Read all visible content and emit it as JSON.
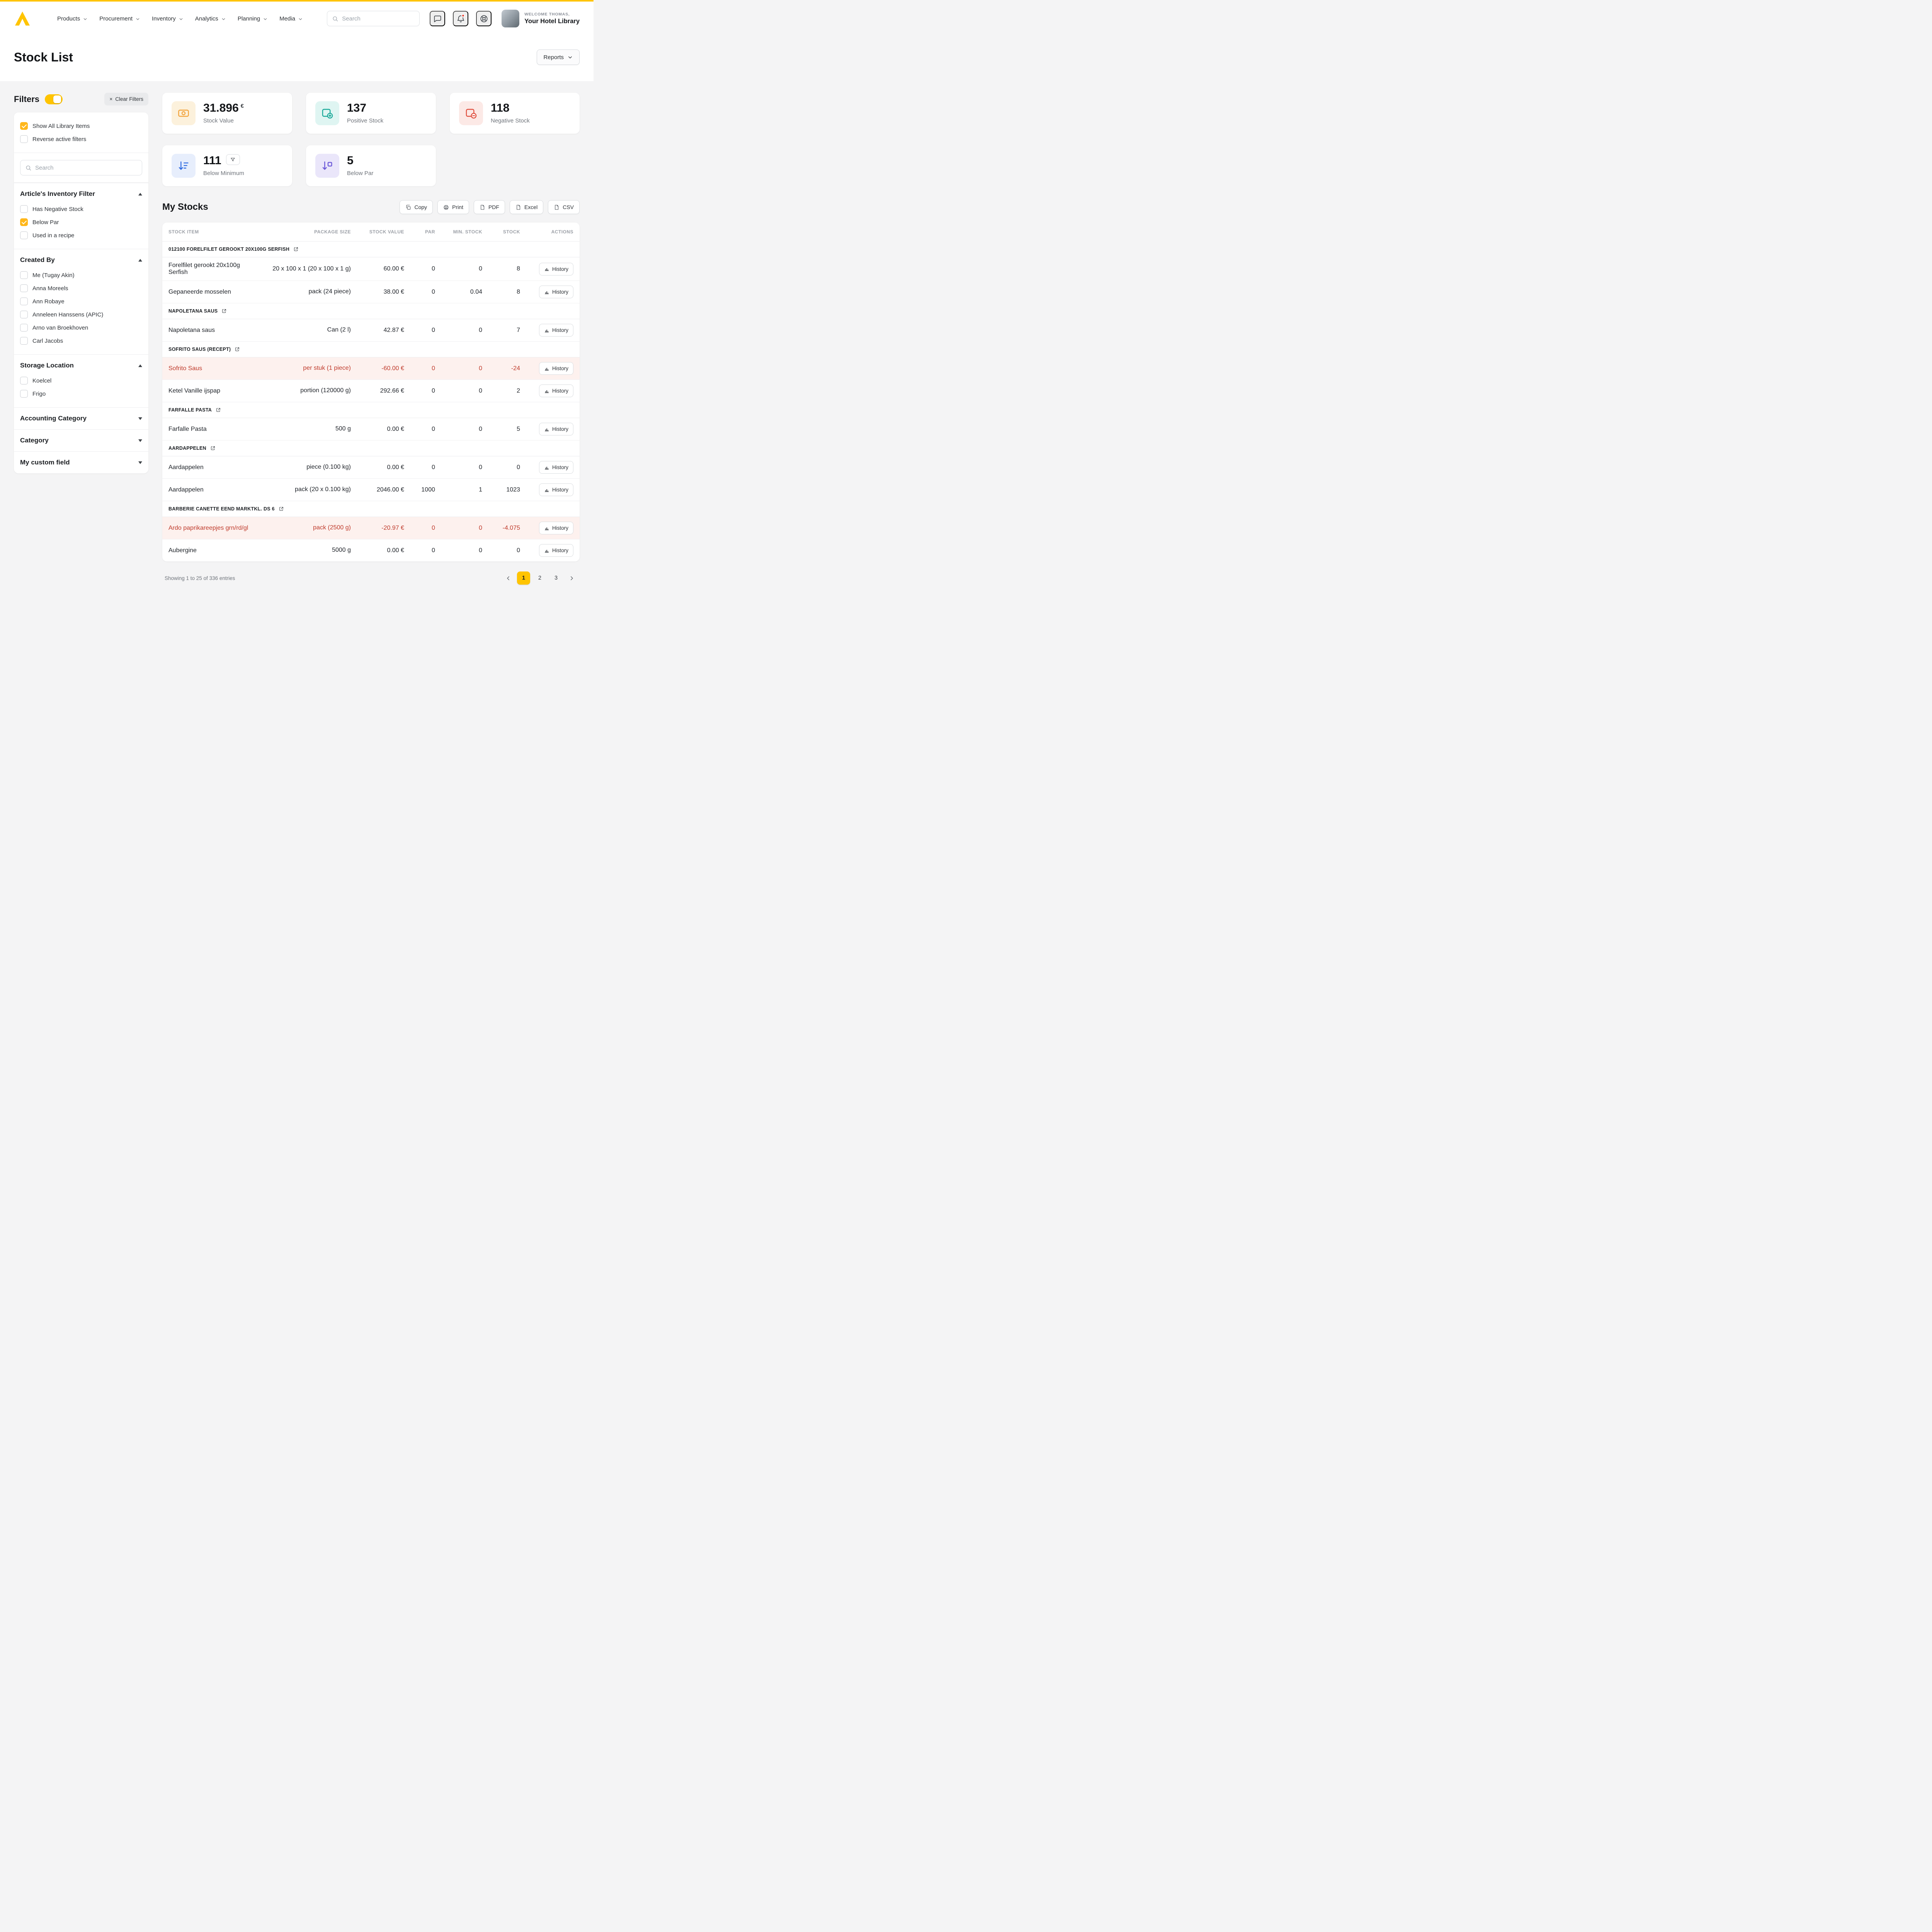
{
  "accent": "#ffc400",
  "header": {
    "nav": [
      {
        "label": "Products"
      },
      {
        "label": "Procurement"
      },
      {
        "label": "Inventory"
      },
      {
        "label": "Analytics"
      },
      {
        "label": "Planning"
      },
      {
        "label": "Media"
      }
    ],
    "search": {
      "placeholder": "Search",
      "icon": "search-icon"
    },
    "action_icons": [
      {
        "name": "chat-icon",
        "badge": false
      },
      {
        "name": "bell-icon",
        "badge": true
      },
      {
        "name": "help-icon",
        "badge": false
      }
    ],
    "user": {
      "welcome": "WELCOME THOMAS,",
      "account": "Your Hotel Library"
    }
  },
  "page": {
    "title": "Stock List",
    "reports_button": "Reports"
  },
  "filters": {
    "title": "Filters",
    "toggle_on": true,
    "clear_icon": "×",
    "clear_button": "Clear Filters",
    "search_placeholder": "Search",
    "top_options": [
      {
        "label": "Show All Library Items",
        "checked": true
      },
      {
        "label": "Reverse active filters",
        "checked": false
      }
    ],
    "sections": [
      {
        "title": "Article's Inventory Filter",
        "expanded": true,
        "options": [
          {
            "label": "Has Negative Stock",
            "checked": false
          },
          {
            "label": "Below Par",
            "checked": true
          },
          {
            "label": "Used in a recipe",
            "checked": false
          }
        ]
      },
      {
        "title": "Created By",
        "expanded": true,
        "options": [
          {
            "label": "Me (Tugay Akin)",
            "checked": false
          },
          {
            "label": "Anna Moreels",
            "checked": false
          },
          {
            "label": "Ann Robaye",
            "checked": false
          },
          {
            "label": "Anneleen Hanssens (APIC)",
            "checked": false
          },
          {
            "label": "Arno van Broekhoven",
            "checked": false
          },
          {
            "label": "Carl Jacobs",
            "checked": false
          }
        ]
      },
      {
        "title": "Storage Location",
        "expanded": true,
        "options": [
          {
            "label": "Koelcel",
            "checked": false
          },
          {
            "label": "Frigo",
            "checked": false
          }
        ]
      },
      {
        "title": "Accounting Category",
        "expanded": false,
        "options": []
      },
      {
        "title": "Category",
        "expanded": false,
        "options": []
      },
      {
        "title": "My custom field",
        "expanded": false,
        "options": []
      }
    ]
  },
  "stats": [
    {
      "value": "31.896",
      "suffix": "€",
      "label": "Stock Value",
      "icon": "banknote-icon",
      "color": "#f2a33c",
      "bg": "#fcf1dc",
      "filter_badge": false
    },
    {
      "value": "137",
      "suffix": "",
      "label": "Positive Stock",
      "icon": "stock-plus-icon",
      "color": "#16a898",
      "bg": "#dff5f2",
      "filter_badge": false
    },
    {
      "value": "118",
      "suffix": "",
      "label": "Negative Stock",
      "icon": "stock-minus-icon",
      "color": "#e04f3f",
      "bg": "#fce9e6",
      "filter_badge": false
    },
    {
      "value": "111",
      "suffix": "",
      "label": "Below Minimum",
      "icon": "below-minimum-icon",
      "color": "#2f6be0",
      "bg": "#e7eefc",
      "filter_badge": true,
      "badge_icon": "funnel-icon"
    },
    {
      "value": "5",
      "suffix": "",
      "label": "Below Par",
      "icon": "below-par-icon",
      "color": "#6a57d8",
      "bg": "#eae6fa",
      "filter_badge": false
    }
  ],
  "stocks": {
    "title": "My Stocks",
    "export_buttons": [
      {
        "label": "Copy",
        "icon": "copy-icon"
      },
      {
        "label": "Print",
        "icon": "print-icon"
      },
      {
        "label": "PDF",
        "icon": "file-pdf-icon"
      },
      {
        "label": "Excel",
        "icon": "file-excel-icon"
      },
      {
        "label": "CSV",
        "icon": "file-csv-icon"
      }
    ],
    "columns": [
      "STOCK ITEM",
      "PACKAGE SIZE",
      "STOCK VALUE",
      "PAR",
      "MIN. STOCK",
      "STOCK",
      "ACTIONS"
    ],
    "history_button": "History",
    "groups": [
      {
        "name": "012100 FORELFILET GEROOKT 20X100G SERFISH",
        "rows": [
          {
            "item": "Forelfilet gerookt 20x100g Serfish",
            "package": "20 x 100 x 1 (20 x 100 x 1 g)",
            "value": "60.00 €",
            "par": "0",
            "min": "0",
            "stock": "8",
            "negative": false
          },
          {
            "item": "Gepaneerde mosselen",
            "package": "pack (24 piece)",
            "value": "38.00 €",
            "par": "0",
            "min": "0.04",
            "stock": "8",
            "negative": false
          }
        ]
      },
      {
        "name": "NAPOLETANA SAUS",
        "rows": [
          {
            "item": "Napoletana saus",
            "package": "Can (2 l)",
            "value": "42.87 €",
            "par": "0",
            "min": "0",
            "stock": "7",
            "negative": false
          }
        ]
      },
      {
        "name": "SOFRITO SAUS (RECEPT)",
        "rows": [
          {
            "item": "Sofrito Saus",
            "package": "per stuk (1 piece)",
            "value": "-60.00 €",
            "par": "0",
            "min": "0",
            "stock": "-24",
            "negative": true
          },
          {
            "item": "Ketel Vanille ijspap",
            "package": "portion (120000 g)",
            "value": "292.66 €",
            "par": "0",
            "min": "0",
            "stock": "2",
            "negative": false
          }
        ]
      },
      {
        "name": "FARFALLE PASTA",
        "rows": [
          {
            "item": "Farfalle Pasta",
            "package": "500 g",
            "value": "0.00 €",
            "par": "0",
            "min": "0",
            "stock": "5",
            "negative": false
          }
        ]
      },
      {
        "name": "AARDAPPELEN",
        "rows": [
          {
            "item": "Aardappelen",
            "package": "piece (0.100 kg)",
            "value": "0.00 €",
            "par": "0",
            "min": "0",
            "stock": "0",
            "negative": false
          },
          {
            "item": "Aardappelen",
            "package": "pack (20 x 0.100 kg)",
            "value": "2046.00 €",
            "par": "1000",
            "min": "1",
            "stock": "1023",
            "negative": false
          }
        ]
      },
      {
        "name": "BARBERIE CANETTE EEND MARKTKL. DS 6",
        "rows": [
          {
            "item": "Ardo paprikareepjes grn/rd/gl",
            "package": "pack (2500 g)",
            "value": "-20.97 €",
            "par": "0",
            "min": "0",
            "stock": "-4.075",
            "negative": true
          },
          {
            "item": "Aubergine",
            "package": "5000 g",
            "value": "0.00 €",
            "par": "0",
            "min": "0",
            "stock": "0",
            "negative": false
          }
        ]
      }
    ],
    "footer": "Showing 1 to 25 of 336 entries",
    "pagination": {
      "pages": [
        "1",
        "2",
        "3"
      ],
      "active": "1"
    }
  }
}
